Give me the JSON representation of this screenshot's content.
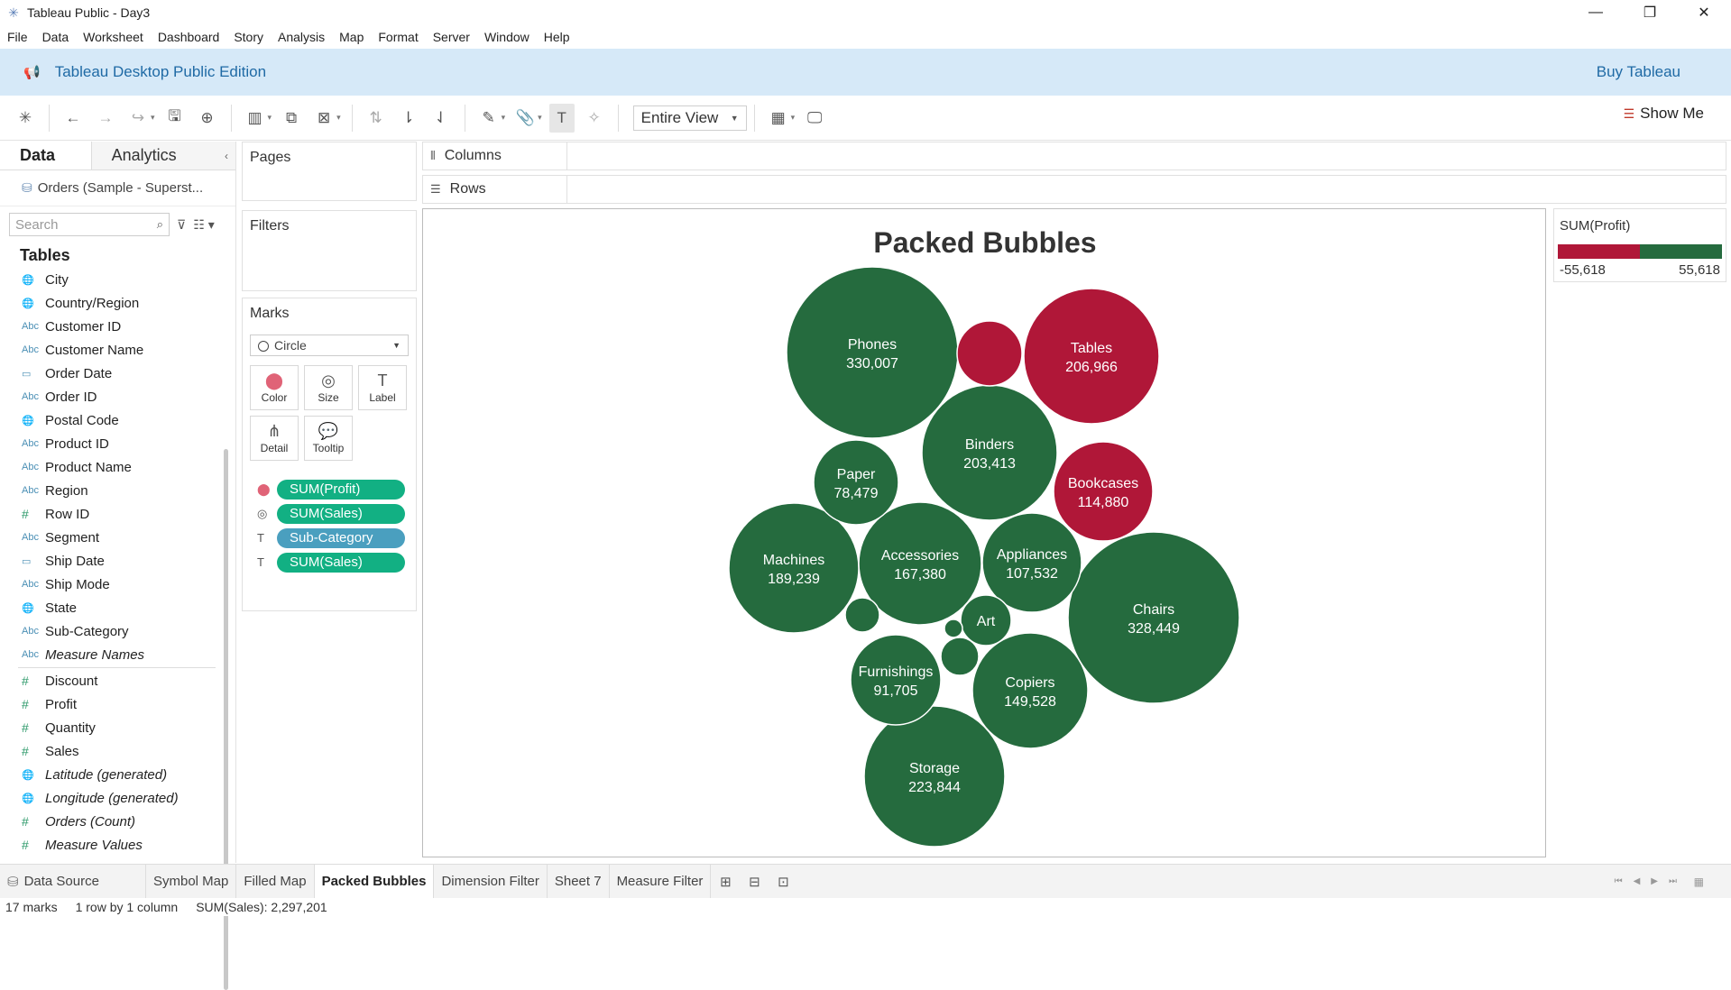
{
  "window": {
    "title": "Tableau Public - Day3",
    "minimize": "—",
    "restore": "❐",
    "close": "✕"
  },
  "menu": [
    "File",
    "Data",
    "Worksheet",
    "Dashboard",
    "Story",
    "Analysis",
    "Map",
    "Format",
    "Server",
    "Window",
    "Help"
  ],
  "banner": {
    "edition": "Tableau Desktop Public Edition",
    "buy": "Buy Tableau"
  },
  "toolbar": {
    "fit": "Entire View",
    "show_me": "Show Me"
  },
  "data_panel": {
    "tab_data": "Data",
    "tab_analytics": "Analytics",
    "datasource": "Orders (Sample - Superst...",
    "search_placeholder": "Search",
    "tables_heading": "Tables",
    "dimensions": [
      {
        "icon": "🌐",
        "name": "City",
        "italic": false
      },
      {
        "icon": "🌐",
        "name": "Country/Region",
        "italic": false
      },
      {
        "icon": "Abc",
        "name": "Customer ID",
        "italic": false
      },
      {
        "icon": "Abc",
        "name": "Customer Name",
        "italic": false
      },
      {
        "icon": "▭",
        "name": "Order Date",
        "italic": false
      },
      {
        "icon": "Abc",
        "name": "Order ID",
        "italic": false
      },
      {
        "icon": "🌐",
        "name": "Postal Code",
        "italic": false
      },
      {
        "icon": "Abc",
        "name": "Product ID",
        "italic": false
      },
      {
        "icon": "Abc",
        "name": "Product Name",
        "italic": false
      },
      {
        "icon": "Abc",
        "name": "Region",
        "italic": false
      },
      {
        "icon": "#",
        "name": "Row ID",
        "italic": false
      },
      {
        "icon": "Abc",
        "name": "Segment",
        "italic": false
      },
      {
        "icon": "▭",
        "name": "Ship Date",
        "italic": false
      },
      {
        "icon": "Abc",
        "name": "Ship Mode",
        "italic": false
      },
      {
        "icon": "🌐",
        "name": "State",
        "italic": false
      },
      {
        "icon": "Abc",
        "name": "Sub-Category",
        "italic": false
      },
      {
        "icon": "Abc",
        "name": "Measure Names",
        "italic": true
      }
    ],
    "measures": [
      {
        "icon": "#",
        "name": "Discount",
        "italic": false
      },
      {
        "icon": "#",
        "name": "Profit",
        "italic": false
      },
      {
        "icon": "#",
        "name": "Quantity",
        "italic": false
      },
      {
        "icon": "#",
        "name": "Sales",
        "italic": false
      },
      {
        "icon": "🌐",
        "name": "Latitude (generated)",
        "italic": true
      },
      {
        "icon": "🌐",
        "name": "Longitude (generated)",
        "italic": true
      },
      {
        "icon": "#",
        "name": "Orders (Count)",
        "italic": true
      },
      {
        "icon": "#",
        "name": "Measure Values",
        "italic": true
      }
    ]
  },
  "shelves": {
    "pages": "Pages",
    "filters": "Filters",
    "marks": "Marks",
    "mark_type": "Circle",
    "mark_buttons": [
      {
        "name": "color",
        "label": "Color",
        "icon": "⬤"
      },
      {
        "name": "size",
        "label": "Size",
        "icon": "◎"
      },
      {
        "name": "label",
        "label": "Label",
        "icon": "T"
      },
      {
        "name": "detail",
        "label": "Detail",
        "icon": "⋔"
      },
      {
        "name": "tooltip",
        "label": "Tooltip",
        "icon": "💬"
      }
    ],
    "pills": [
      {
        "icon": "⬤",
        "label": "SUM(Profit)",
        "kind": "measure"
      },
      {
        "icon": "◎",
        "label": "SUM(Sales)",
        "kind": "measure"
      },
      {
        "icon": "T",
        "label": "Sub-Category",
        "kind": "dimension"
      },
      {
        "icon": "T",
        "label": "SUM(Sales)",
        "kind": "measure"
      }
    ],
    "columns": "Columns",
    "rows": "Rows"
  },
  "legend": {
    "title": "SUM(Profit)",
    "min": "-55,618",
    "max": "55,618",
    "neg_color": "#b01738",
    "pos_color": "#256b3e"
  },
  "chart_data": {
    "type": "packed-bubble",
    "title": "Packed Bubbles",
    "size_measure": "SUM(Sales)",
    "color_measure": "SUM(Profit)",
    "bubbles": [
      {
        "name": "Phones",
        "sales": 330007,
        "label": "330,007",
        "profit": "positive"
      },
      {
        "name": "Chairs",
        "sales": 328449,
        "label": "328,449",
        "profit": "positive"
      },
      {
        "name": "Storage",
        "sales": 223844,
        "label": "223,844",
        "profit": "positive"
      },
      {
        "name": "Tables",
        "sales": 206966,
        "label": "206,966",
        "profit": "negative"
      },
      {
        "name": "Binders",
        "sales": 203413,
        "label": "203,413",
        "profit": "positive"
      },
      {
        "name": "Machines",
        "sales": 189239,
        "label": "189,239",
        "profit": "positive"
      },
      {
        "name": "Accessories",
        "sales": 167380,
        "label": "167,380",
        "profit": "positive"
      },
      {
        "name": "Copiers",
        "sales": 149528,
        "label": "149,528",
        "profit": "positive"
      },
      {
        "name": "Bookcases",
        "sales": 114880,
        "label": "114,880",
        "profit": "negative"
      },
      {
        "name": "Appliances",
        "sales": 107532,
        "label": "107,532",
        "profit": "positive"
      },
      {
        "name": "Furnishings",
        "sales": 91705,
        "label": "91,705",
        "profit": "positive"
      },
      {
        "name": "Paper",
        "sales": 78479,
        "label": "78,479",
        "profit": "positive"
      },
      {
        "name": "Art",
        "sales": null,
        "label": "",
        "profit": "positive"
      },
      {
        "name": "",
        "sales": null,
        "label": "",
        "profit": "negative"
      },
      {
        "name": "",
        "sales": null,
        "label": "",
        "profit": "positive"
      },
      {
        "name": "",
        "sales": null,
        "label": "",
        "profit": "positive"
      },
      {
        "name": "",
        "sales": null,
        "label": "",
        "profit": "positive"
      }
    ]
  },
  "sheet_tabs": {
    "data_source": "Data Source",
    "sheets": [
      "Symbol Map",
      "Filled Map",
      "Packed Bubbles",
      "Dimension Filter",
      "Sheet 7",
      "Measure Filter"
    ],
    "active": "Packed Bubbles"
  },
  "status": {
    "marks": "17 marks",
    "dims": "1 row by 1 column",
    "sum": "SUM(Sales): 2,297,201"
  }
}
